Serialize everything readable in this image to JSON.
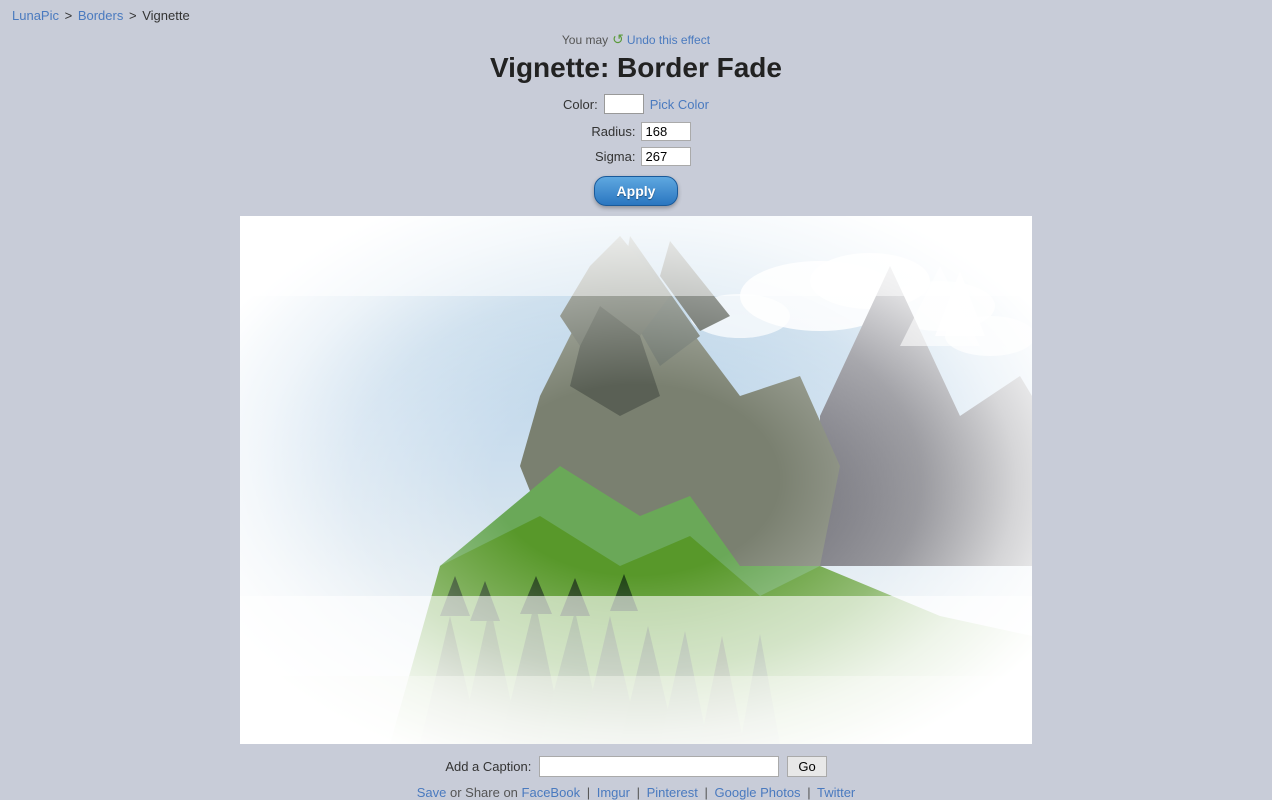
{
  "breadcrumb": {
    "site": "LunaPic",
    "section": "Borders",
    "current": "Vignette",
    "site_href": "#",
    "section_href": "#"
  },
  "header": {
    "undo_prefix": "You may",
    "undo_label": "Undo this effect",
    "title": "Vignette: Border Fade"
  },
  "controls": {
    "color_label": "Color:",
    "pick_color_label": "Pick Color",
    "radius_label": "Radius:",
    "radius_value": "168",
    "sigma_label": "Sigma:",
    "sigma_value": "267",
    "apply_label": "Apply"
  },
  "caption": {
    "label": "Add a Caption:",
    "placeholder": "",
    "go_label": "Go"
  },
  "footer": {
    "share_text": "or Share on",
    "save_label": "Save",
    "links": [
      {
        "label": "FaceBook",
        "href": "#"
      },
      {
        "label": "Imgur",
        "href": "#"
      },
      {
        "label": "Pinterest",
        "href": "#"
      },
      {
        "label": "Google Photos",
        "href": "#"
      },
      {
        "label": "Twitter",
        "href": "#"
      }
    ]
  }
}
